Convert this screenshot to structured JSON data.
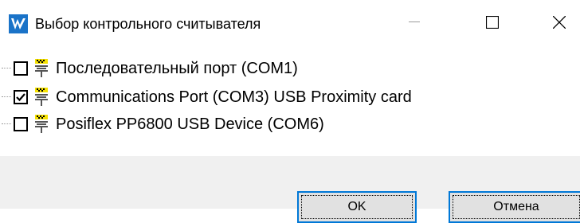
{
  "window": {
    "title": "Выбор контрольного считывателя",
    "icon": "app-logo-icon",
    "controls": [
      "minimize-icon",
      "maximize-icon",
      "close-icon"
    ]
  },
  "devices": [
    {
      "label": "Последовательный порт (COM1)",
      "checked": false,
      "icon": "serial-port-icon"
    },
    {
      "label": "Communications Port (COM3) USB Proximity card",
      "checked": true,
      "icon": "serial-port-icon"
    },
    {
      "label": "Posiflex PP6800 USB Device (COM6)",
      "checked": false,
      "icon": "serial-port-icon"
    }
  ],
  "buttons": {
    "ok_label": "OK",
    "cancel_label": "Отмена"
  },
  "colors": {
    "accent": "#0078d7",
    "footer_bg": "#f0f0f0",
    "icon_yellow": "#f5e100"
  }
}
